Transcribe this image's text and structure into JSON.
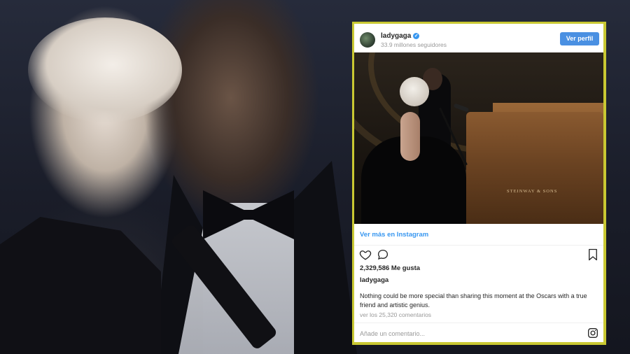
{
  "background": {
    "description_icon": "photo-background"
  },
  "embed": {
    "border_color": "#c9c832",
    "accent_color": "#3897f0",
    "header": {
      "username": "ladygaga",
      "verified_icon": "verified-badge-icon",
      "followers": "33.9 millones seguidores",
      "profile_button": "Ver perfil"
    },
    "post": {
      "piano_logo": "STEINWAY & SONS",
      "see_more": "Ver más en Instagram",
      "icons": {
        "like": "heart-icon",
        "comment": "comment-icon",
        "save": "bookmark-icon",
        "brand": "instagram-logo-icon"
      },
      "likes": "2,329,586 Me gusta",
      "caption_user": "ladygaga",
      "caption": "Nothing could be more special than sharing this moment at the Oscars with a true friend and artistic genius.",
      "view_comments": "ver los 25,320 comentarios",
      "comment_placeholder": "Añade un comentario..."
    }
  }
}
